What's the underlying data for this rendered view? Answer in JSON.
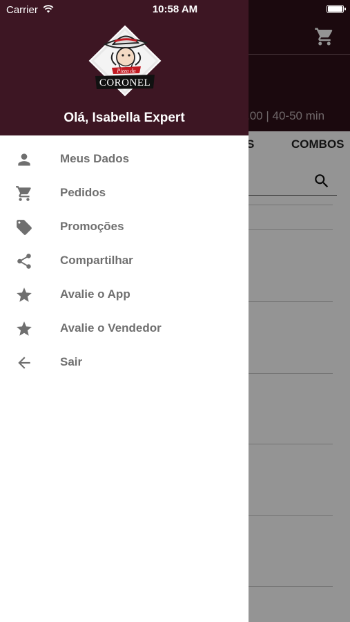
{
  "status_bar": {
    "carrier": "Carrier",
    "time": "10:58 AM"
  },
  "drawer": {
    "greeting": "Olá, Isabella Expert",
    "logo": {
      "top_text": "Pizza da",
      "brand": "CORONEL"
    },
    "menu": [
      {
        "label": "Meus Dados",
        "icon": "person-icon"
      },
      {
        "label": "Pedidos",
        "icon": "cart-icon"
      },
      {
        "label": "Promoções",
        "icon": "tag-icon"
      },
      {
        "label": "Compartilhar",
        "icon": "share-icon"
      },
      {
        "label": "Avalie o App",
        "icon": "star-icon"
      },
      {
        "label": "Avalie o Vendedor",
        "icon": "star-icon"
      },
      {
        "label": "Sair",
        "icon": "arrow-back-icon"
      }
    ]
  },
  "background": {
    "info_text": ".00 | 40-50 min",
    "tabs": [
      "S",
      "COMBOS"
    ]
  },
  "colors": {
    "header": "#3d1623",
    "header_behind": "#2f1019",
    "menu_text": "#6f6f6f",
    "icon": "#6f6f6f"
  }
}
